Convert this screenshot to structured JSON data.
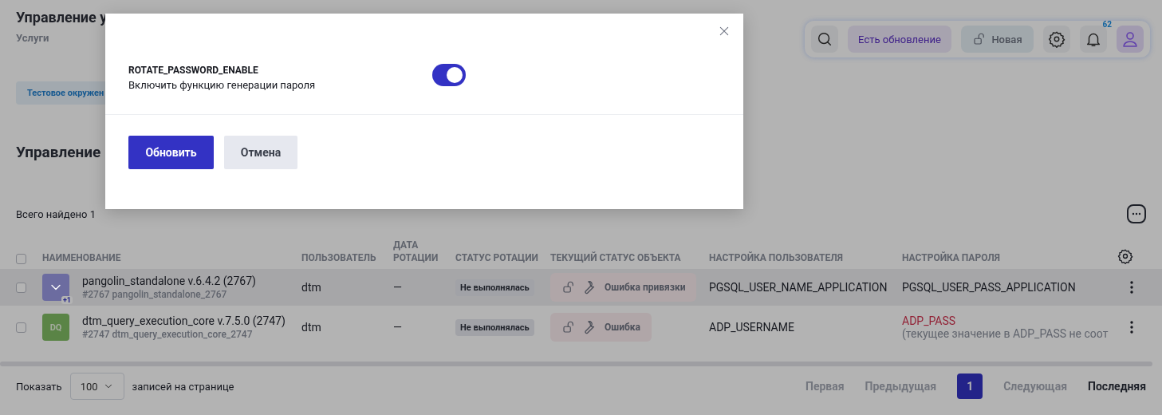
{
  "header": {
    "title": "Управление у",
    "subtitle": "Услуги"
  },
  "toolbar": {
    "update_button": "Есть обновление",
    "version_button": "Новая",
    "notifications_count": "62"
  },
  "environment_badge": "Тестовое окружен",
  "section_title": "Управление",
  "total": "Всего найдено 1",
  "table": {
    "select_all_checked": false,
    "columns": [
      "НАИМЕНОВАНИЕ",
      "ПОЛЬЗОВАТЕЛЬ",
      "ДАТА РОТАЦИИ",
      "СТАТУС РОТАЦИИ",
      "ТЕКУЩИЙ СТАТУС ОБЪЕКТА",
      "НАСТРОЙКА ПОЛЬЗОВАТЕЛЯ",
      "НАСТРОЙКА ПАРОЛЯ"
    ],
    "rows": [
      {
        "checked": false,
        "hovered": true,
        "avatar": {
          "kind": "icon",
          "color": "#6c6ca0",
          "extra": "+1"
        },
        "name": "pangolin_standalone v.6.4.2 (2767)",
        "id_line": "#2767 pangolin_standalone_2767",
        "user": "dtm",
        "rotation_date": "—",
        "rotation_status": "Не выполнялась",
        "object_status": "Ошибка привязки",
        "user_setting": "PGSQL_USER_NAME_APPLICATION",
        "password_setting": {
          "value": "PGSQL_USER_PASS_APPLICATION",
          "error": false
        }
      },
      {
        "checked": false,
        "hovered": false,
        "avatar": {
          "kind": "initials",
          "color": "#5a8446",
          "initials": "DQ"
        },
        "name": "dtm_query_execution_core v.7.5.0 (2747)",
        "id_line": "#2747 dtm_query_execution_core_2747",
        "user": "dtm",
        "rotation_date": "—",
        "rotation_status": "Не выполнялась",
        "object_status": "Ошибка",
        "user_setting": "ADP_USERNAME",
        "password_setting": {
          "value": "ADP_PASS",
          "error": true,
          "note": "(текущее значение в ADP_PASS не соот"
        }
      }
    ]
  },
  "footer": {
    "show_label": "Показать",
    "page_size": "100",
    "per_page_label": "записей на странице",
    "pages": [
      {
        "label": "Первая",
        "kind": "link",
        "disabled": true,
        "selected": false
      },
      {
        "label": "Предыдущая",
        "kind": "link",
        "disabled": true,
        "selected": false
      },
      {
        "label": "1",
        "kind": "page",
        "disabled": false,
        "selected": true
      },
      {
        "label": "Следующая",
        "kind": "link",
        "disabled": true,
        "selected": false
      },
      {
        "label": "Последняя",
        "kind": "link",
        "disabled": false,
        "selected": false
      }
    ]
  },
  "modal": {
    "setting_name": "ROTATE_PASSWORD_ENABLE",
    "description": "Включить функцию генерации пароля",
    "enabled": true,
    "buttons": [
      {
        "label": "Обновить",
        "kind": "primary"
      },
      {
        "label": "Отмена",
        "kind": "secondary"
      }
    ]
  }
}
